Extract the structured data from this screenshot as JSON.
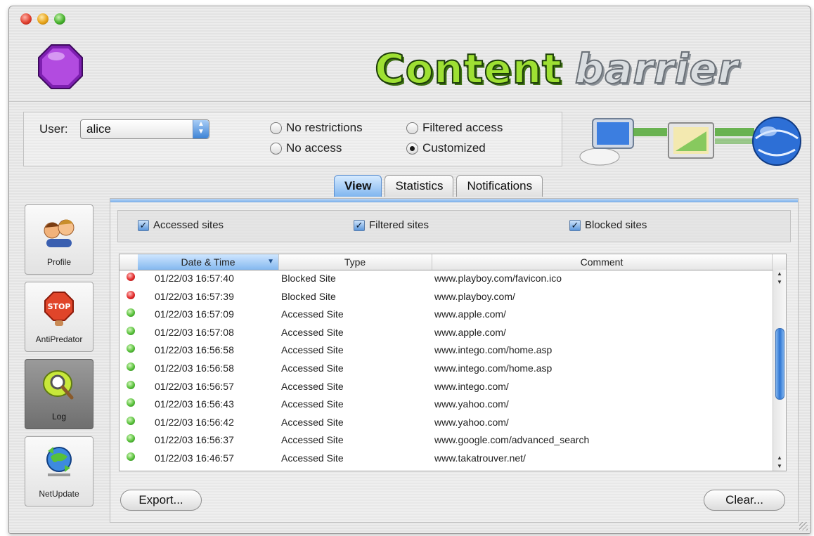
{
  "window": {
    "logo_text_1": "Content",
    "logo_text_2": "barrier"
  },
  "user_panel": {
    "user_label": "User:",
    "user_value": "alice",
    "radios": [
      {
        "label": "No restrictions",
        "selected": false
      },
      {
        "label": "No access",
        "selected": false
      },
      {
        "label": "Filtered access",
        "selected": false
      },
      {
        "label": "Customized",
        "selected": true
      }
    ]
  },
  "tabs": [
    {
      "label": "View",
      "active": true
    },
    {
      "label": "Statistics",
      "active": false
    },
    {
      "label": "Notifications",
      "active": false
    }
  ],
  "sidebar": {
    "items": [
      {
        "label": "Profile",
        "icon": "profile-people-icon",
        "active": false
      },
      {
        "label": "AntiPredator",
        "icon": "stop-sign-hand-icon",
        "active": false
      },
      {
        "label": "Log",
        "icon": "magnifier-log-icon",
        "active": true
      },
      {
        "label": "NetUpdate",
        "icon": "globe-update-icon",
        "active": false
      }
    ]
  },
  "filters": {
    "accessed": {
      "label": "Accessed sites",
      "checked": true
    },
    "filtered": {
      "label": "Filtered sites",
      "checked": true
    },
    "blocked": {
      "label": "Blocked sites",
      "checked": true
    }
  },
  "table": {
    "columns": {
      "date": "Date & Time",
      "type": "Type",
      "comment": "Comment"
    },
    "rows": [
      {
        "status": "blocked",
        "date": "01/22/03 16:57:40",
        "type": "Blocked Site",
        "comment": "www.playboy.com/favicon.ico"
      },
      {
        "status": "blocked",
        "date": "01/22/03 16:57:39",
        "type": "Blocked Site",
        "comment": "www.playboy.com/"
      },
      {
        "status": "accessed",
        "date": "01/22/03 16:57:09",
        "type": "Accessed Site",
        "comment": "www.apple.com/"
      },
      {
        "status": "accessed",
        "date": "01/22/03 16:57:08",
        "type": "Accessed Site",
        "comment": "www.apple.com/"
      },
      {
        "status": "accessed",
        "date": "01/22/03 16:56:58",
        "type": "Accessed Site",
        "comment": "www.intego.com/home.asp"
      },
      {
        "status": "accessed",
        "date": "01/22/03 16:56:58",
        "type": "Accessed Site",
        "comment": "www.intego.com/home.asp"
      },
      {
        "status": "accessed",
        "date": "01/22/03 16:56:57",
        "type": "Accessed Site",
        "comment": "www.intego.com/"
      },
      {
        "status": "accessed",
        "date": "01/22/03 16:56:43",
        "type": "Accessed Site",
        "comment": "www.yahoo.com/"
      },
      {
        "status": "accessed",
        "date": "01/22/03 16:56:42",
        "type": "Accessed Site",
        "comment": "www.yahoo.com/"
      },
      {
        "status": "accessed",
        "date": "01/22/03 16:56:37",
        "type": "Accessed Site",
        "comment": "www.google.com/advanced_search"
      },
      {
        "status": "accessed",
        "date": "01/22/03 16:46:57",
        "type": "Accessed Site",
        "comment": "www.takatrouver.net/"
      }
    ]
  },
  "buttons": {
    "export": "Export...",
    "clear": "Clear..."
  },
  "colors": {
    "blocked": "#e32b2b",
    "accessed": "#58c13a",
    "accent": "#3d83d6"
  }
}
